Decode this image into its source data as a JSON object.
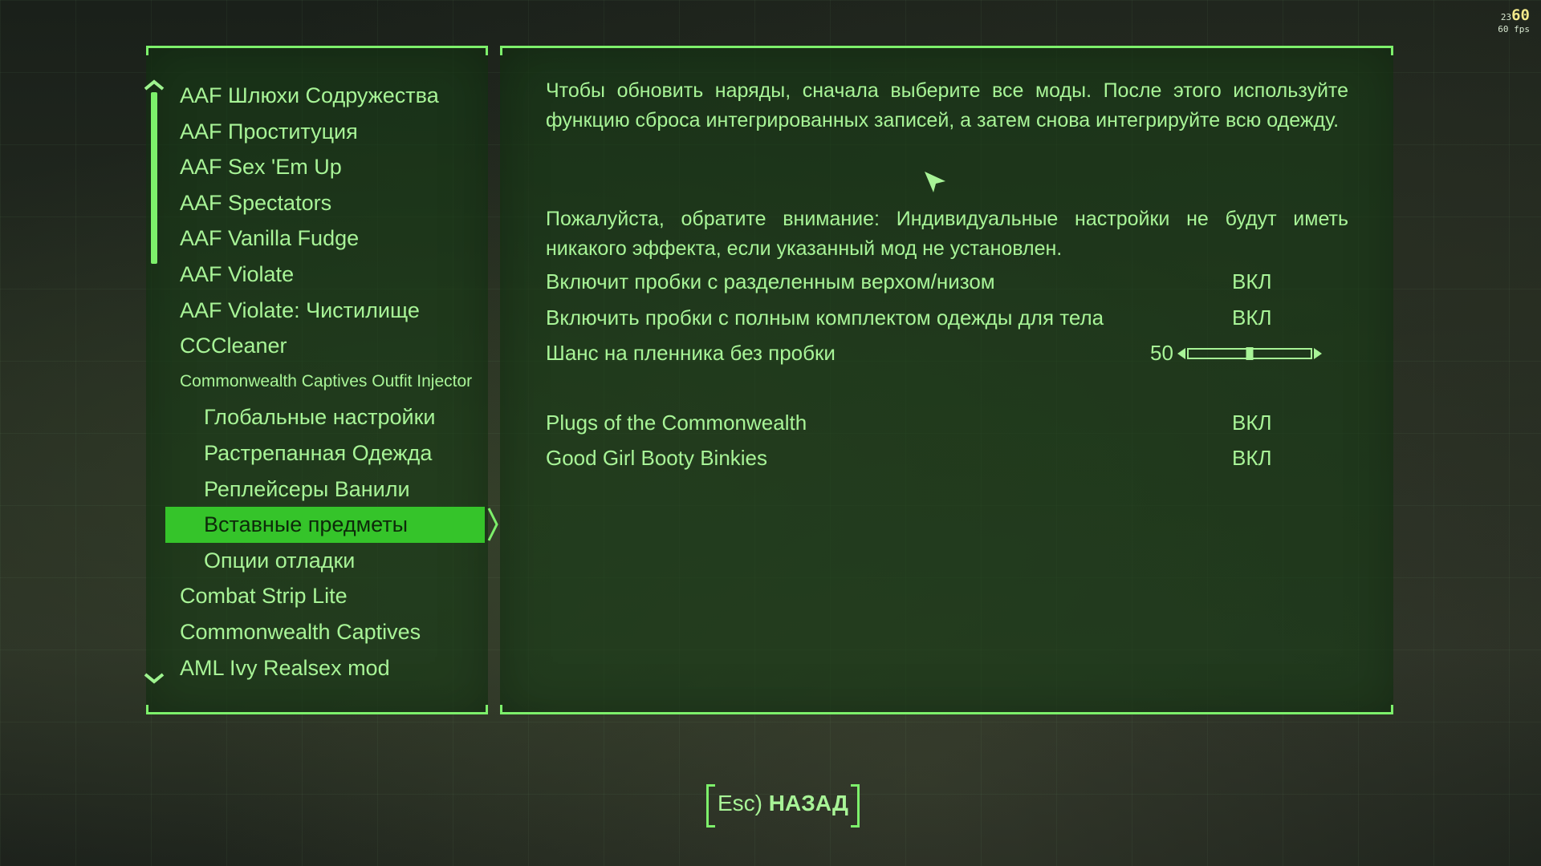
{
  "perf": {
    "fps_small": "23",
    "fps_big": "60",
    "fps_label": "60 fps"
  },
  "mod_list": {
    "items": [
      {
        "label": "AAF Шлюхи Содружества"
      },
      {
        "label": "AAF Проституция"
      },
      {
        "label": "AAF Sex 'Em Up"
      },
      {
        "label": "AAF Spectators"
      },
      {
        "label": "AAF Vanilla Fudge"
      },
      {
        "label": "AAF Violate"
      },
      {
        "label": "AAF Violate: Чистилище"
      },
      {
        "label": "CCCleaner"
      },
      {
        "label": "Commonwealth Captives Outfit Injector"
      },
      {
        "label": "Глобальные настройки"
      },
      {
        "label": "Растрепанная Одежда"
      },
      {
        "label": "Реплейсеры Ванили"
      },
      {
        "label": "Вставные предметы"
      },
      {
        "label": "Опции отладки"
      },
      {
        "label": "Combat Strip Lite"
      },
      {
        "label": "Commonwealth Captives"
      },
      {
        "label": "AML Ivy Realsex mod"
      }
    ],
    "selected_index": 12
  },
  "content": {
    "intro": "Чтобы обновить наряды, сначала выберите все моды.  После этого используйте функцию сброса интегрированных записей, а затем снова интегрируйте всю одежду.",
    "notice": "Пожалуйста, обратите внимание: Индивидуальные настройки не будут иметь никакого эффекта, если указанный мод не установлен.",
    "settings": [
      {
        "label": "Включит пробки с разделенным верхом/низом",
        "value": "ВКЛ"
      },
      {
        "label": "Включить пробки с полным комплектом одежды для тела",
        "value": "ВКЛ"
      }
    ],
    "slider": {
      "label": "Шанс на пленника без пробки",
      "value": "50",
      "level": 0.5
    },
    "mods": [
      {
        "label": "Plugs of the Commonwealth",
        "value": "ВКЛ"
      },
      {
        "label": "Good Girl Booty Binkies",
        "value": "ВКЛ"
      }
    ]
  },
  "footer": {
    "key": "Esc)",
    "back_label": "НАЗАД"
  },
  "colors": {
    "accent": "#7df06b",
    "text": "#a8f497",
    "selected_bg": "#35c42a",
    "panel_bg": "#183c16"
  }
}
